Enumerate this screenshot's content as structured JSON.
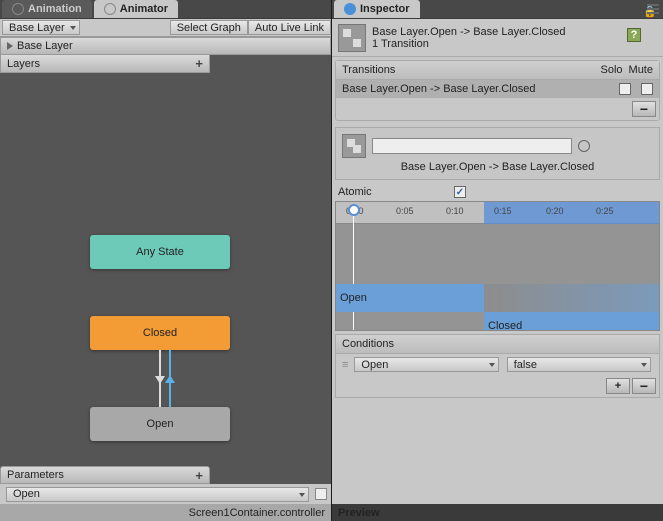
{
  "tabs": {
    "animation": "Animation",
    "animator": "Animator",
    "inspector": "Inspector"
  },
  "toolbar": {
    "layer_dd": "Base Layer",
    "select_graph": "Select Graph",
    "auto_live": "Auto Live Link",
    "base_layer_btn": "Base Layer",
    "layers": "Layers"
  },
  "nodes": {
    "any": "Any State",
    "closed": "Closed",
    "open": "Open"
  },
  "params": {
    "header": "Parameters",
    "p1": "Open"
  },
  "status": "Screen1Container.controller",
  "inspector": {
    "title": "Base Layer.Open -> Base Layer.Closed",
    "sub": "1 Transition",
    "transitions": "Transitions",
    "solo": "Solo",
    "mute": "Mute",
    "trow": "Base Layer.Open -> Base Layer.Closed",
    "tlabel": "Base Layer.Open -> Base Layer.Closed",
    "atomic": "Atomic",
    "ticks": [
      "0:00",
      "0:05",
      "0:10",
      "0:15",
      "0:20",
      "0:25"
    ],
    "clip_open": "Open",
    "clip_closed": "Closed",
    "conditions": "Conditions",
    "cond_param": "Open",
    "cond_val": "false",
    "preview": "Preview"
  }
}
